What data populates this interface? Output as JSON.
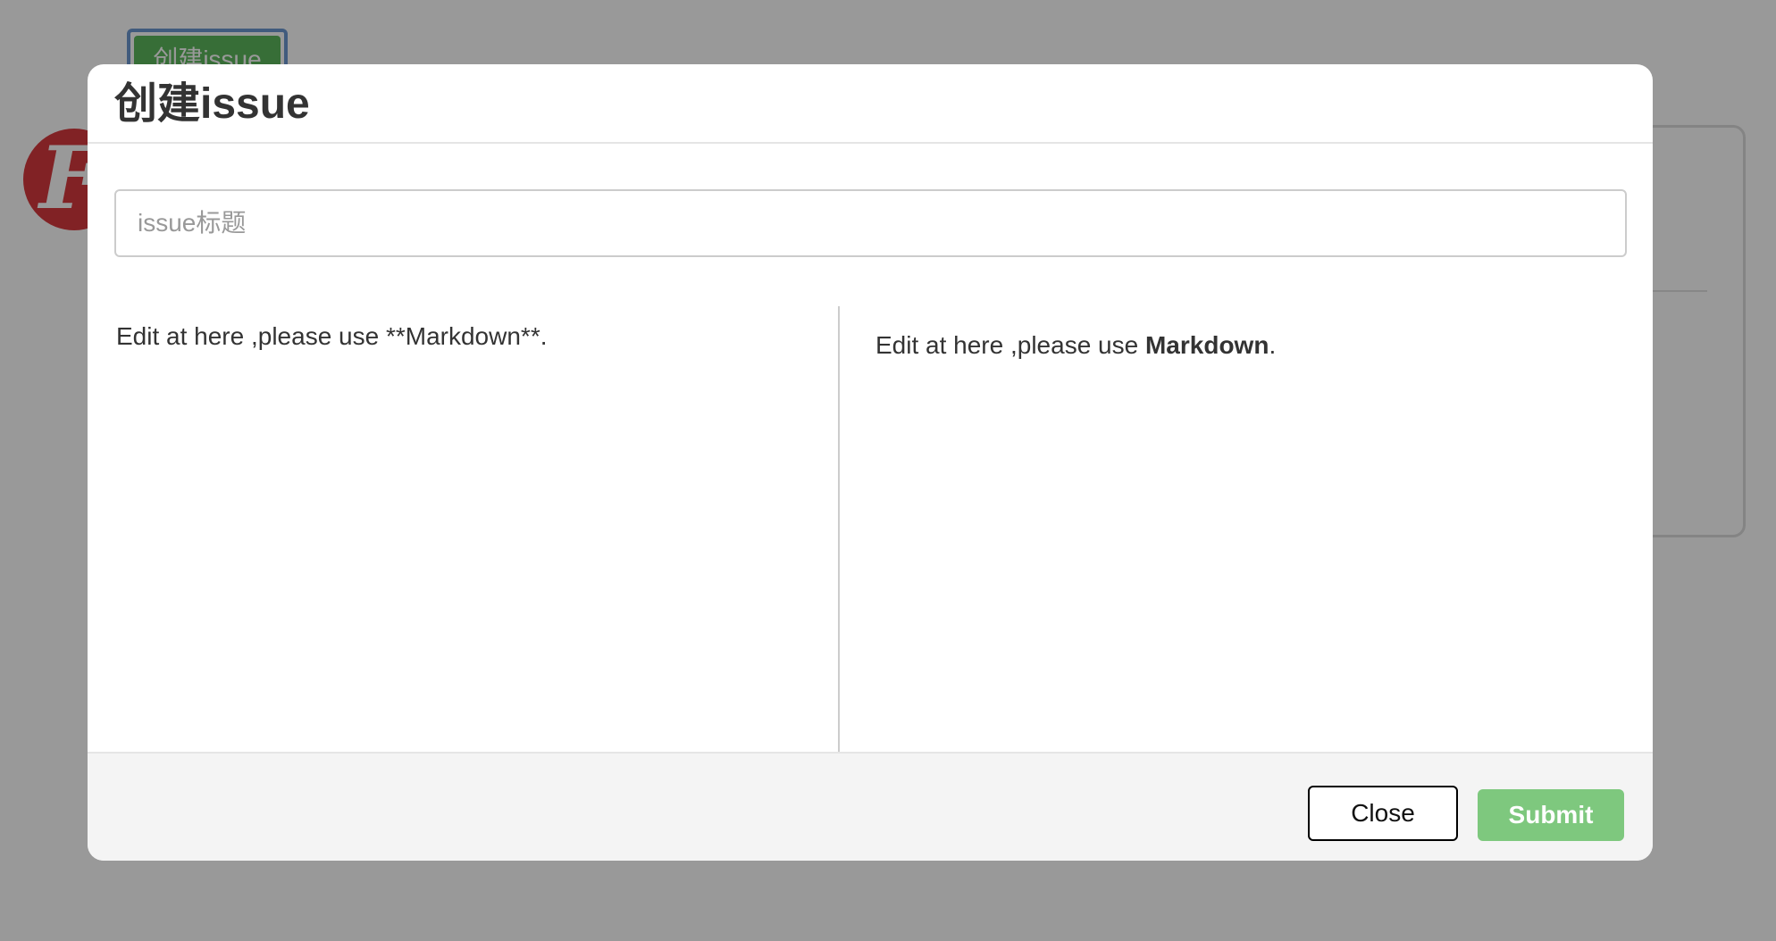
{
  "background": {
    "create_button_label": "创建issue"
  },
  "modal": {
    "title": "创建issue",
    "title_input": {
      "placeholder": "issue标题",
      "value": ""
    },
    "editor": {
      "value": "Edit at here ,please use **Markdown**."
    },
    "preview": {
      "before": "Edit at here ,please use ",
      "bold": "Markdown",
      "after": "."
    },
    "footer": {
      "close_label": "Close",
      "submit_label": "Submit"
    }
  },
  "colors": {
    "backdrop": "#999999",
    "submit": "#7ec87e",
    "create_button": "#5cb85c",
    "logo": "#d83a3e"
  },
  "icons": {
    "logo": "brand-logo-icon",
    "resize": "resize-handle-icon"
  }
}
